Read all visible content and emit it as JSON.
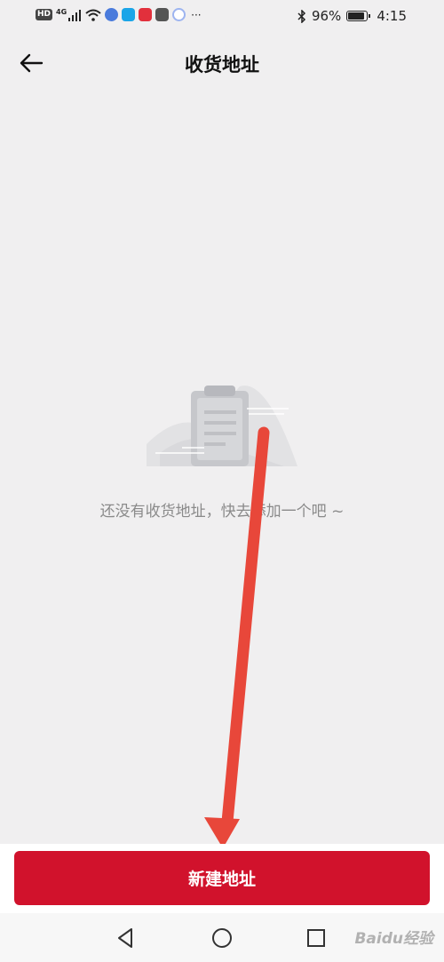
{
  "status_bar": {
    "hd_badge": "HD",
    "network": "4G",
    "ellipsis": "···",
    "battery_percent": "96%",
    "battery_level": 0.96,
    "time": "4:15",
    "icons": [
      "hd-icon",
      "signal-icon",
      "wifi-icon",
      "music-app-icon",
      "search-app-icon",
      "red-app-icon",
      "shield-app-icon",
      "circle-app-icon",
      "bluetooth-icon",
      "battery-icon"
    ]
  },
  "header": {
    "title": "收货地址",
    "back_icon": "arrow-left-icon"
  },
  "empty_state": {
    "illustration": "clipboard-illustration",
    "message": "还没有收货地址，快去添加一个吧 ~"
  },
  "footer": {
    "button_label": "新建地址",
    "button_color": "#d1122c"
  },
  "system_nav": {
    "back": "triangle-back-icon",
    "home": "circle-home-icon",
    "recents": "square-recents-icon"
  },
  "watermark": "Baidu经验",
  "annotation": {
    "arrow_color": "#e8473a"
  }
}
